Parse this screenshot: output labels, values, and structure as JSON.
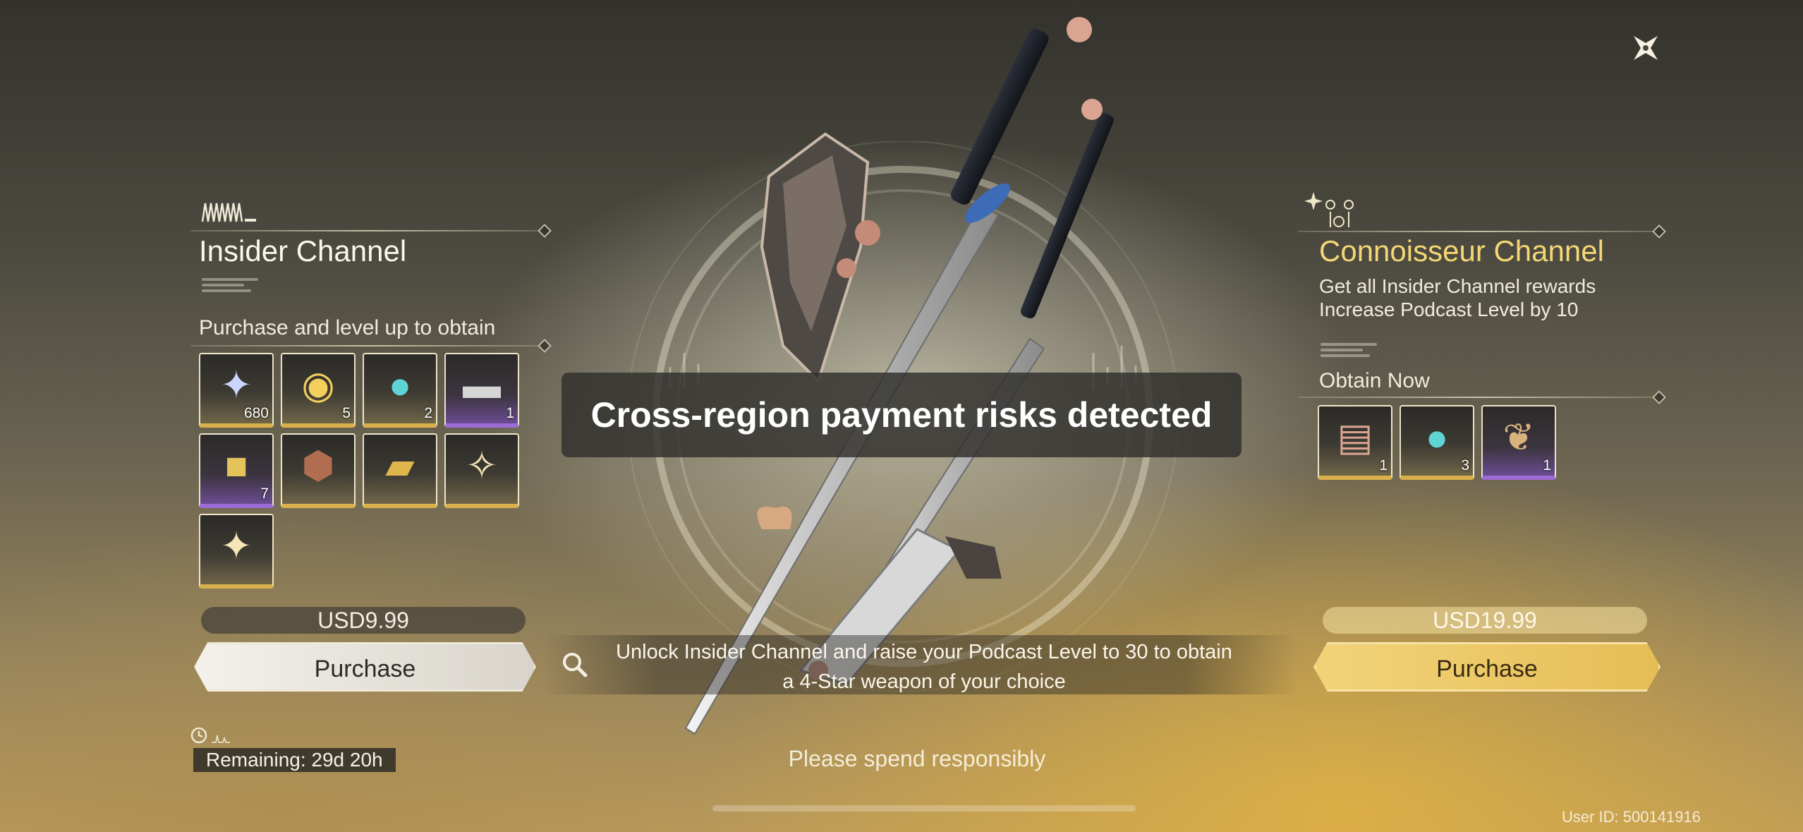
{
  "close": {
    "icon": "close-x-icon"
  },
  "left": {
    "title": "Insider Channel",
    "subtitle": "Purchase and level up to obtain",
    "rewards": [
      {
        "icon": "star-shard-icon",
        "count": "680",
        "rarity": "gold"
      },
      {
        "icon": "gold-coin-icon",
        "count": "5",
        "rarity": "gold"
      },
      {
        "icon": "teal-orb-icon",
        "count": "2",
        "rarity": "gold"
      },
      {
        "icon": "supply-chest-icon",
        "count": "1",
        "rarity": "purple"
      },
      {
        "icon": "gold-cube-icon",
        "count": "7",
        "rarity": "purple"
      },
      {
        "icon": "bronze-gem-icon",
        "count": "",
        "rarity": "gold"
      },
      {
        "icon": "gold-case-icon",
        "count": "",
        "rarity": "gold"
      },
      {
        "icon": "sparkle-charm-icon",
        "count": "",
        "rarity": "gold"
      },
      {
        "icon": "spirit-sparkle-icon",
        "count": "",
        "rarity": "gold"
      }
    ],
    "price": "USD9.99",
    "purchase_label": "Purchase",
    "remaining": "Remaining: 29d 20h"
  },
  "center": {
    "alert": "Cross-region payment risks detected",
    "unlock_text": "Unlock Insider Channel and raise your Podcast Level to 30 to obtain a 4-Star weapon of your choice",
    "spend_text": "Please spend responsibly"
  },
  "right": {
    "title": "Connoisseur Channel",
    "desc_line1": "Get all Insider Channel rewards",
    "desc_line2": "Increase Podcast Level by 10",
    "obtain_label": "Obtain Now",
    "rewards": [
      {
        "icon": "record-card-icon",
        "count": "1",
        "rarity": "gold"
      },
      {
        "icon": "teal-orb-icon",
        "count": "3",
        "rarity": "gold"
      },
      {
        "icon": "ginkgo-leaf-icon",
        "count": "1",
        "rarity": "purple"
      }
    ],
    "price": "USD19.99",
    "purchase_label": "Purchase"
  },
  "footer": {
    "user_id": "User ID: 500141916"
  },
  "colors": {
    "accent_gold": "#f4d774",
    "purple_rarity": "#9c6bd6",
    "gold_rarity": "#d9b04b"
  }
}
